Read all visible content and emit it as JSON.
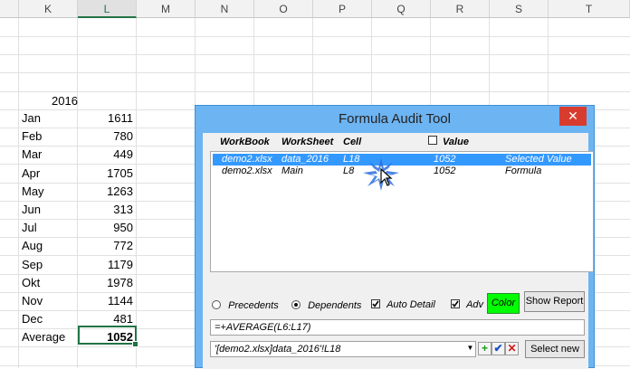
{
  "columns": [
    "K",
    "L",
    "M",
    "N",
    "O",
    "P",
    "Q",
    "R",
    "S",
    "T"
  ],
  "year_label": "2016",
  "rows": [
    {
      "label": "Jan",
      "value": "1611"
    },
    {
      "label": "Feb",
      "value": "780"
    },
    {
      "label": "Mar",
      "value": "449"
    },
    {
      "label": "Apr",
      "value": "1705"
    },
    {
      "label": "May",
      "value": "1263"
    },
    {
      "label": "Jun",
      "value": "313"
    },
    {
      "label": "Jul",
      "value": "950"
    },
    {
      "label": "Aug",
      "value": "772"
    },
    {
      "label": "Sep",
      "value": "1179"
    },
    {
      "label": "Okt",
      "value": "1978"
    },
    {
      "label": "Nov",
      "value": "1144"
    },
    {
      "label": "Dec",
      "value": "481"
    },
    {
      "label": "Average",
      "value": "1052"
    }
  ],
  "dialog": {
    "title": "Formula Audit Tool",
    "close_glyph": "✕",
    "headers": {
      "workbook": "WorkBook",
      "worksheet": "WorkSheet",
      "cell": "Cell",
      "value": "Value"
    },
    "entries": [
      {
        "workbook": "demo2.xlsx",
        "worksheet": "data_2016",
        "cell": "L18",
        "value": "1052",
        "type": "Selected Value"
      },
      {
        "workbook": "demo2.xlsx",
        "worksheet": "Main",
        "cell": "L8",
        "value": "1052",
        "type": "Formula"
      }
    ],
    "options": {
      "precedents": "Precedents",
      "dependents": "Dependents",
      "auto_detail": "Auto Detail",
      "adv": "Adv"
    },
    "buttons": {
      "color": "Color",
      "show_report": "Show Report",
      "select_new": "Select new"
    },
    "formula": "=+AVERAGE(L6:L17)",
    "reference": "'[demo2.xlsx]data_2016'!L18",
    "colors": {
      "accent": "#6db4f2",
      "selection": "#3399ff",
      "color_button": "#00ff00",
      "close": "#d83c2f"
    }
  }
}
